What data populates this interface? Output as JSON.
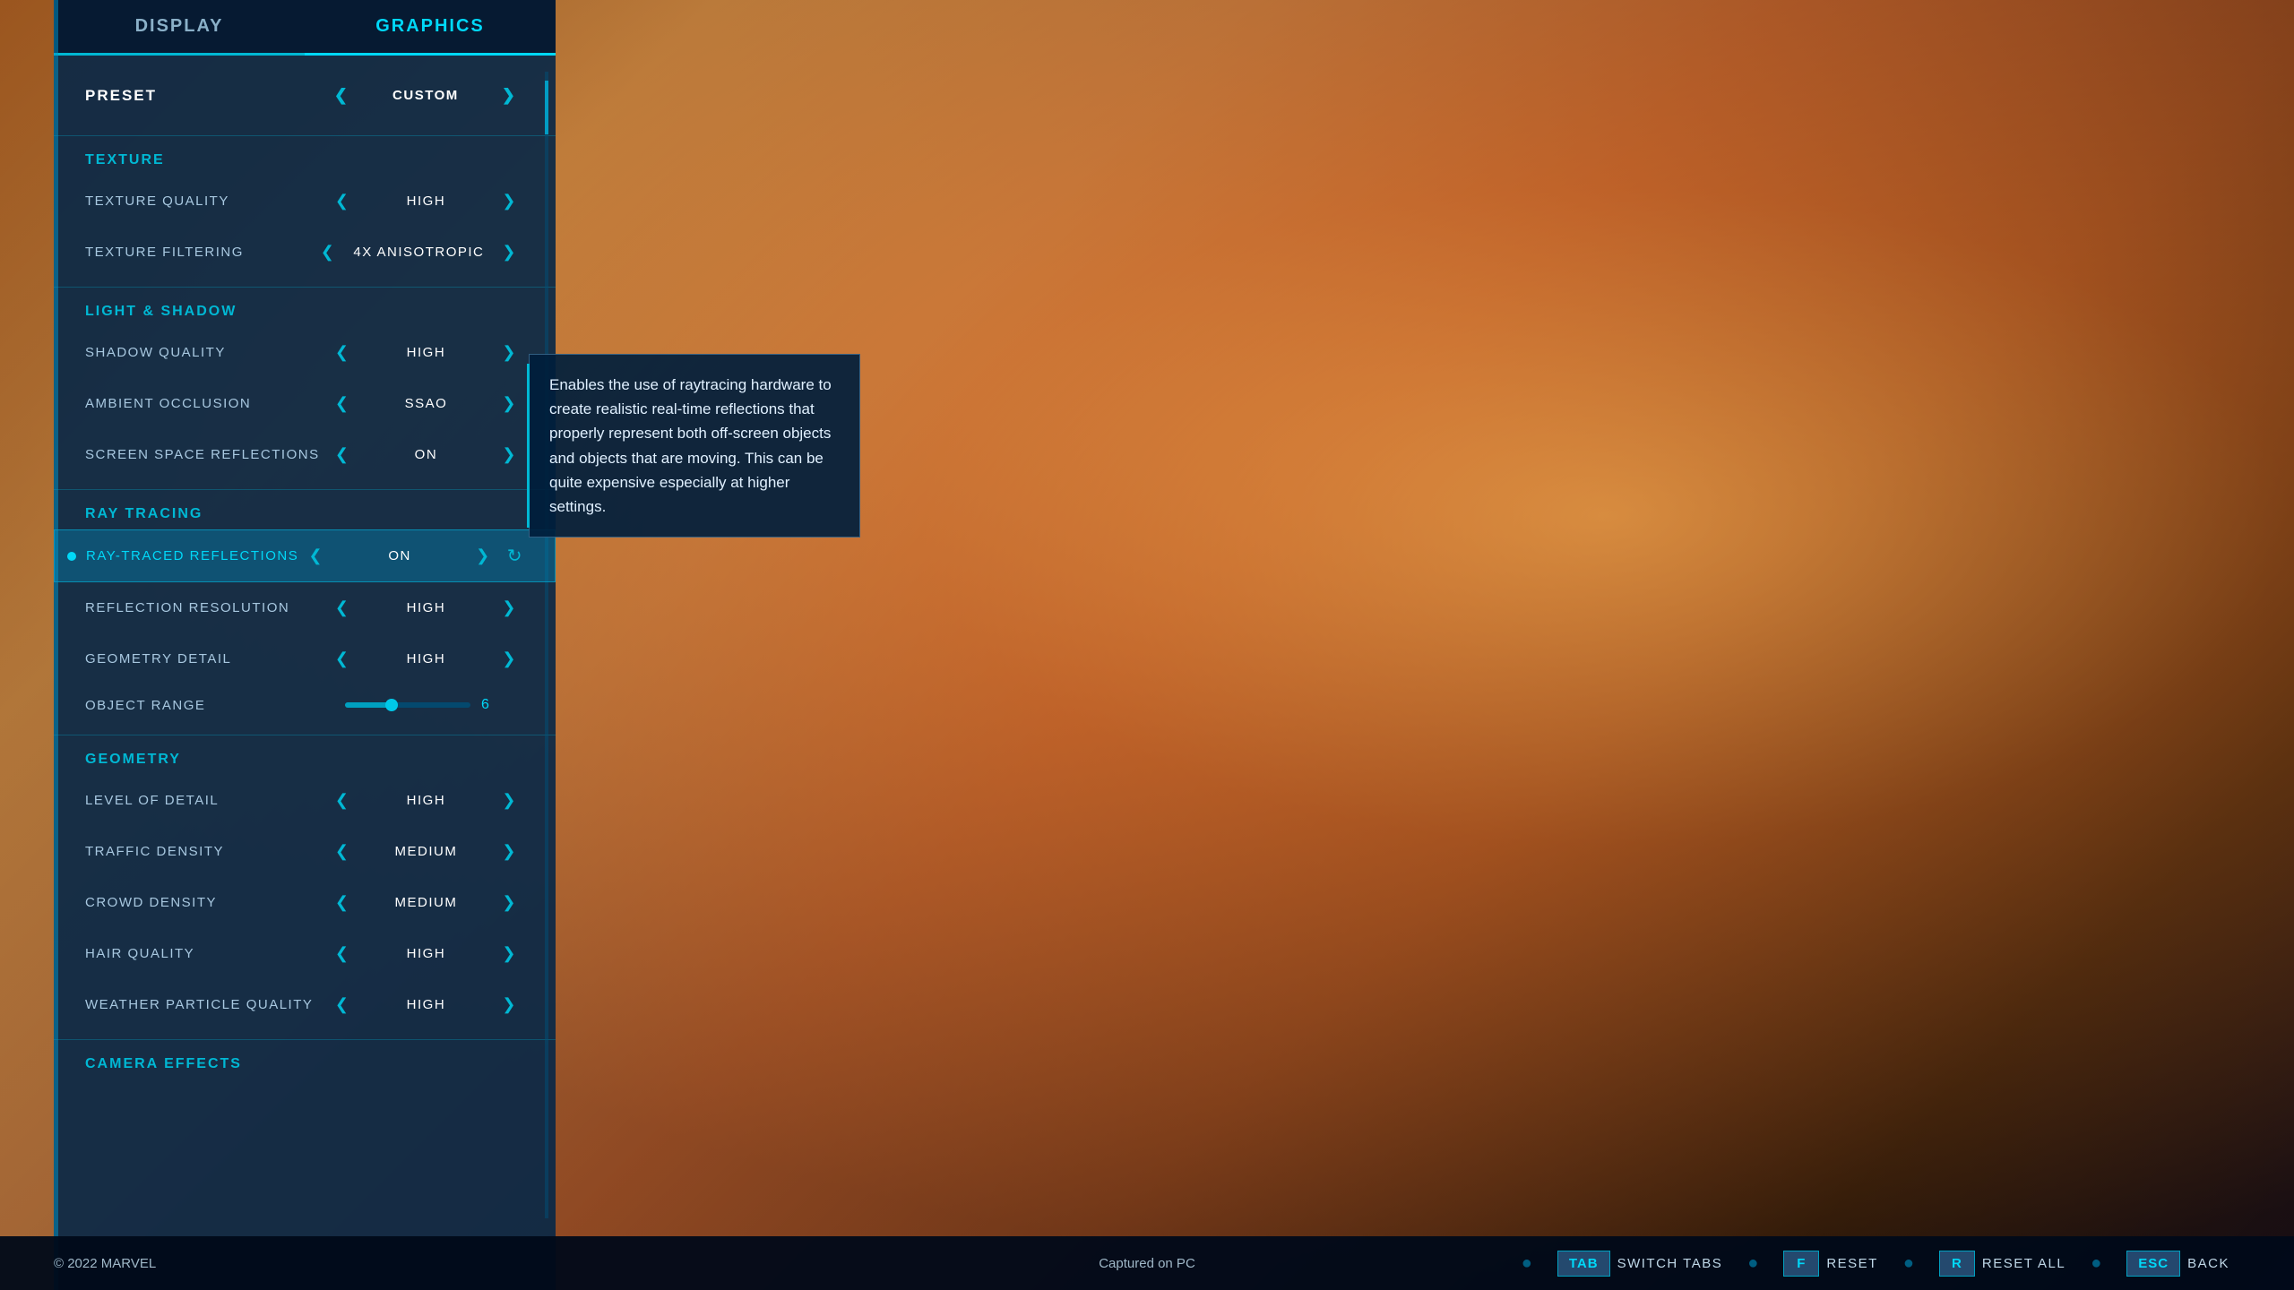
{
  "background": {
    "color1": "#c8722a",
    "color2": "#e8a050"
  },
  "tabs": {
    "display": "DISPLAY",
    "graphics": "GRAPHICS",
    "active": "graphics"
  },
  "preset": {
    "label": "PRESET",
    "value": "CUSTOM"
  },
  "sections": {
    "texture": {
      "header": "TEXTURE",
      "items": [
        {
          "name": "TEXTURE QUALITY",
          "value": "HIGH"
        },
        {
          "name": "TEXTURE FILTERING",
          "value": "4X ANISOTROPIC"
        }
      ]
    },
    "lightShadow": {
      "header": "LIGHT & SHADOW",
      "items": [
        {
          "name": "SHADOW QUALITY",
          "value": "HIGH"
        },
        {
          "name": "AMBIENT OCCLUSION",
          "value": "SSAO"
        },
        {
          "name": "SCREEN SPACE REFLECTIONS",
          "value": "ON"
        }
      ]
    },
    "rayTracing": {
      "header": "RAY TRACING",
      "items": [
        {
          "name": "RAY-TRACED REFLECTIONS",
          "value": "ON",
          "highlighted": true
        },
        {
          "name": "REFLECTION RESOLUTION",
          "value": "HIGH"
        },
        {
          "name": "GEOMETRY DETAIL",
          "value": "HIGH"
        },
        {
          "name": "OBJECT RANGE",
          "value": "6",
          "slider": true,
          "sliderPercent": 42
        }
      ]
    },
    "geometry": {
      "header": "GEOMETRY",
      "items": [
        {
          "name": "LEVEL OF DETAIL",
          "value": "HIGH"
        },
        {
          "name": "TRAFFIC DENSITY",
          "value": "MEDIUM"
        },
        {
          "name": "CROWD DENSITY",
          "value": "MEDIUM"
        },
        {
          "name": "HAIR QUALITY",
          "value": "HIGH"
        },
        {
          "name": "WEATHER PARTICLE QUALITY",
          "value": "HIGH"
        }
      ]
    },
    "cameraEffects": {
      "header": "CAMERA EFFECTS"
    }
  },
  "tooltip": {
    "text": "Enables the use of raytracing hardware to create realistic real-time reflections that properly represent both off-screen objects and objects that are moving. This can be quite expensive especially at higher settings."
  },
  "bottomBar": {
    "copyright": "© 2022 MARVEL",
    "captured": "Captured on PC",
    "controls": [
      {
        "key": "TAB",
        "label": "SWITCH TABS"
      },
      {
        "key": "F",
        "label": "RESET"
      },
      {
        "key": "R",
        "label": "RESET ALL"
      },
      {
        "key": "ESC",
        "label": "BACK"
      }
    ]
  }
}
